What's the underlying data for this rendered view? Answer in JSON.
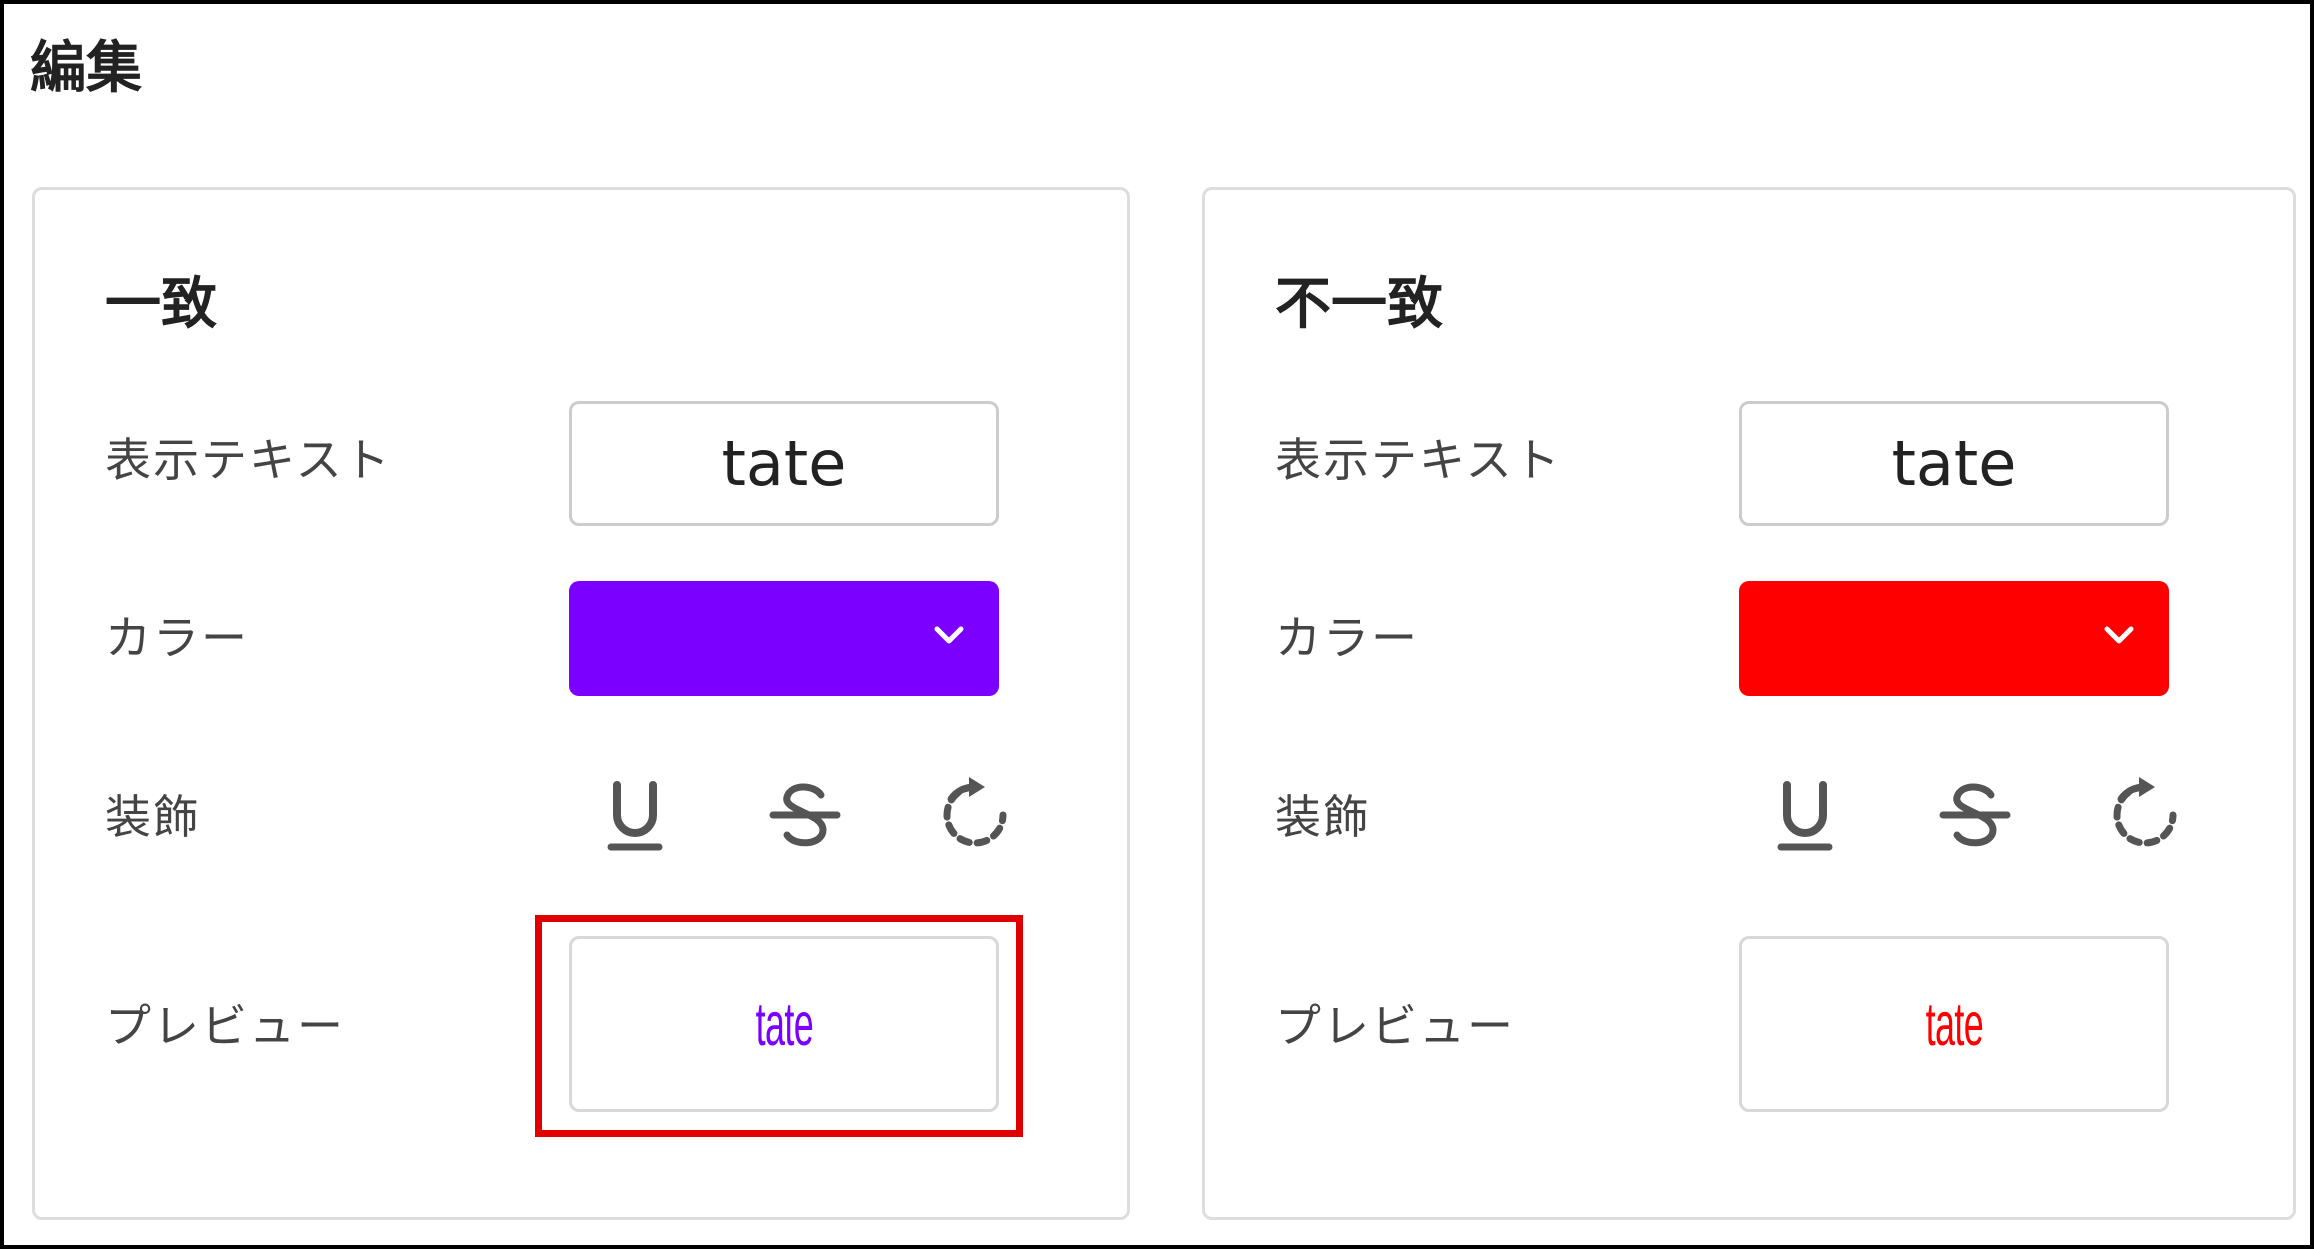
{
  "page": {
    "title": "編集"
  },
  "panels": [
    {
      "title": "一致",
      "text_label": "表示テキスト",
      "text_value": "tate",
      "color_label": "カラー",
      "color_value": "#7b00ff",
      "decoration_label": "装飾",
      "decoration_icons": [
        "underline-icon",
        "strikethrough-icon",
        "rotate-icon"
      ],
      "preview_label": "プレビュー",
      "preview_text": "tate",
      "preview_color": "#7b00ff"
    },
    {
      "title": "不一致",
      "text_label": "表示テキスト",
      "text_value": "tate",
      "color_label": "カラー",
      "color_value": "#ff0000",
      "decoration_label": "装飾",
      "decoration_icons": [
        "underline-icon",
        "strikethrough-icon",
        "rotate-icon"
      ],
      "preview_label": "プレビュー",
      "preview_text": "tate",
      "preview_color": "#ff0000"
    }
  ],
  "highlight_color": "#e00000",
  "chevron_icon": "chevron-down-icon"
}
